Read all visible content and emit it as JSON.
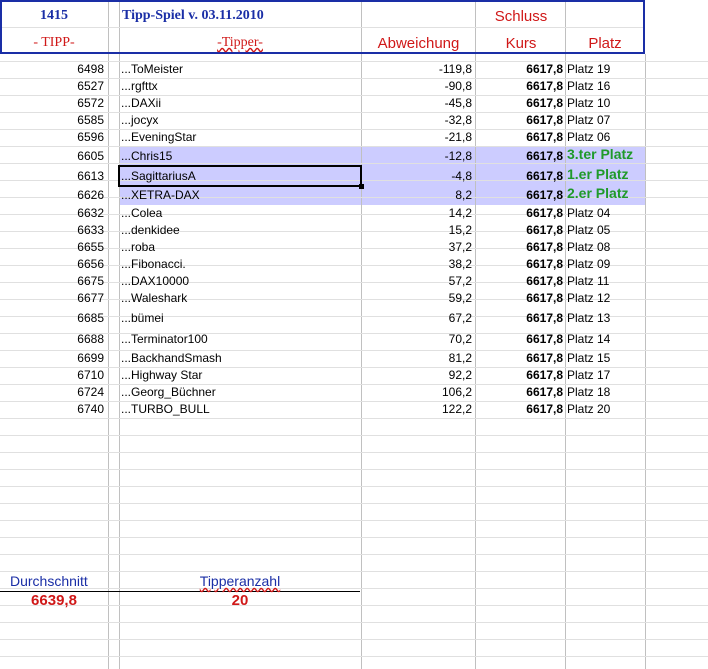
{
  "header": {
    "cell_a1": "1415",
    "cell_b1": "Tipp-Spiel v. 03.11.2010",
    "cell_d1": "Schluss",
    "cell_a2": "- TIPP-",
    "cell_b2": "-Tipper-",
    "cell_c2": "Abweichung",
    "cell_d2": "Kurs",
    "cell_e2": "Platz"
  },
  "rows": [
    {
      "tipp": "6498",
      "tipper": "...ToMeister",
      "abw": "-119,8",
      "kurs": "6617,8",
      "platz": "Platz 19"
    },
    {
      "tipp": "6527",
      "tipper": "...rgfttx",
      "abw": "-90,8",
      "kurs": "6617,8",
      "platz": "Platz 16"
    },
    {
      "tipp": "6572",
      "tipper": "...DAXii",
      "abw": "-45,8",
      "kurs": "6617,8",
      "platz": "Platz 10"
    },
    {
      "tipp": "6585",
      "tipper": "...jocyx",
      "abw": "-32,8",
      "kurs": "6617,8",
      "platz": "Platz 07"
    },
    {
      "tipp": "6596",
      "tipper": "...EveningStar",
      "abw": "-21,8",
      "kurs": "6617,8",
      "platz": "Platz 06"
    },
    {
      "tipp": "6605",
      "tipper": "...Chris15",
      "abw": "-12,8",
      "kurs": "6617,8",
      "platz": "3.ter Platz"
    },
    {
      "tipp": "6613",
      "tipper": "...SagittariusA",
      "abw": "-4,8",
      "kurs": "6617,8",
      "platz": "1.er Platz"
    },
    {
      "tipp": "6626",
      "tipper": "...XETRA-DAX",
      "abw": "8,2",
      "kurs": "6617,8",
      "platz": "2.er Platz"
    },
    {
      "tipp": "6632",
      "tipper": "...Colea",
      "abw": "14,2",
      "kurs": "6617,8",
      "platz": "Platz 04"
    },
    {
      "tipp": "6633",
      "tipper": "...denkidee",
      "abw": "15,2",
      "kurs": "6617,8",
      "platz": "Platz 05"
    },
    {
      "tipp": "6655",
      "tipper": "...roba",
      "abw": "37,2",
      "kurs": "6617,8",
      "platz": "Platz 08"
    },
    {
      "tipp": "6656",
      "tipper": "...Fibonacci.",
      "abw": "38,2",
      "kurs": "6617,8",
      "platz": "Platz 09"
    },
    {
      "tipp": "6675",
      "tipper": "...DAX10000",
      "abw": "57,2",
      "kurs": "6617,8",
      "platz": "Platz 11"
    },
    {
      "tipp": "6677",
      "tipper": "...Waleshark",
      "abw": "59,2",
      "kurs": "6617,8",
      "platz": "Platz 12"
    },
    {
      "tipp": "6685",
      "tipper": "...bümei",
      "abw": "67,2",
      "kurs": "6617,8",
      "platz": "Platz 13"
    },
    {
      "tipp": "6688",
      "tipper": "...Terminator100",
      "abw": "70,2",
      "kurs": "6617,8",
      "platz": "Platz 14"
    },
    {
      "tipp": "6699",
      "tipper": "...BackhandSmash",
      "abw": "81,2",
      "kurs": "6617,8",
      "platz": "Platz 15"
    },
    {
      "tipp": "6710",
      "tipper": "...Highway Star",
      "abw": "92,2",
      "kurs": "6617,8",
      "platz": "Platz 17"
    },
    {
      "tipp": "6724",
      "tipper": "...Georg_Büchner",
      "abw": "106,2",
      "kurs": "6617,8",
      "platz": "Platz 18"
    },
    {
      "tipp": "6740",
      "tipper": "...TURBO_BULL",
      "abw": "122,2",
      "kurs": "6617,8",
      "platz": "Platz 20"
    }
  ],
  "footer": {
    "avg_label": "Durchschnitt",
    "avg_value": "6639,8",
    "count_label": "Tipperanzahl",
    "count_value": "20"
  },
  "colors": {
    "header_blue": "#1a2ea6",
    "header_red": "#d01818",
    "highlight": "#ccccff",
    "winner_green": "#1f9a2a"
  }
}
